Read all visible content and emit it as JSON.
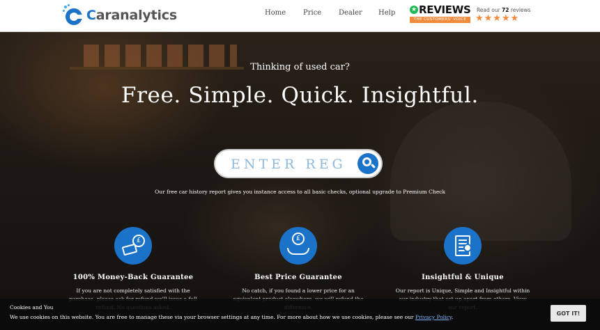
{
  "header": {
    "logo_text_c": "C",
    "logo_text_rest": "aranalytics",
    "nav": [
      {
        "label": "Home"
      },
      {
        "label": "Price"
      },
      {
        "label": "Dealer"
      },
      {
        "label": "Help"
      }
    ],
    "reviews": {
      "brand": "REVIEWS",
      "tagline": "THE CUSTOMERS' VOICE",
      "read_prefix": "Read our",
      "count": "72",
      "read_suffix": "reviews",
      "rating_stars": 4.5,
      "stars_glyphs": "★★★★★"
    }
  },
  "hero": {
    "subtitle": "Thinking of used car?",
    "title": "Free. Simple. Quick. Insightful.",
    "search_placeholder": "ENTER REG",
    "note": "Our free car history report gives you instance access to all basic checks, optional upgrade to Premium Check"
  },
  "features": [
    {
      "icon": "money-back-icon",
      "title": "100% Money-Back Guarantee",
      "text": "If you are not completely satisfied with the purchase, please ask for refund we'll issue a full refund. No questions asked."
    },
    {
      "icon": "price-guarantee-icon",
      "title": "Best Price Guarantee",
      "text": "No catch, if you found a lower price for an equivalent product elsewhere, we will refund the difference."
    },
    {
      "icon": "report-insight-icon",
      "title": "Insightful & Unique",
      "text": "Our report is Unique, Simple and Insightful within our industry that set up apart from others. View our report."
    }
  ],
  "cookie": {
    "title": "Cookies and You",
    "text": "We use cookies on this website. You are free to manage these via your browser settings at any time. For more about how we use cookies, please see our",
    "link": "Privacy Policy",
    "text_end": ".",
    "button": "GOT IT!"
  },
  "colors": {
    "brand_blue": "#1a73c9",
    "review_orange": "#f08a3c",
    "search_text": "#8fb8dc"
  }
}
